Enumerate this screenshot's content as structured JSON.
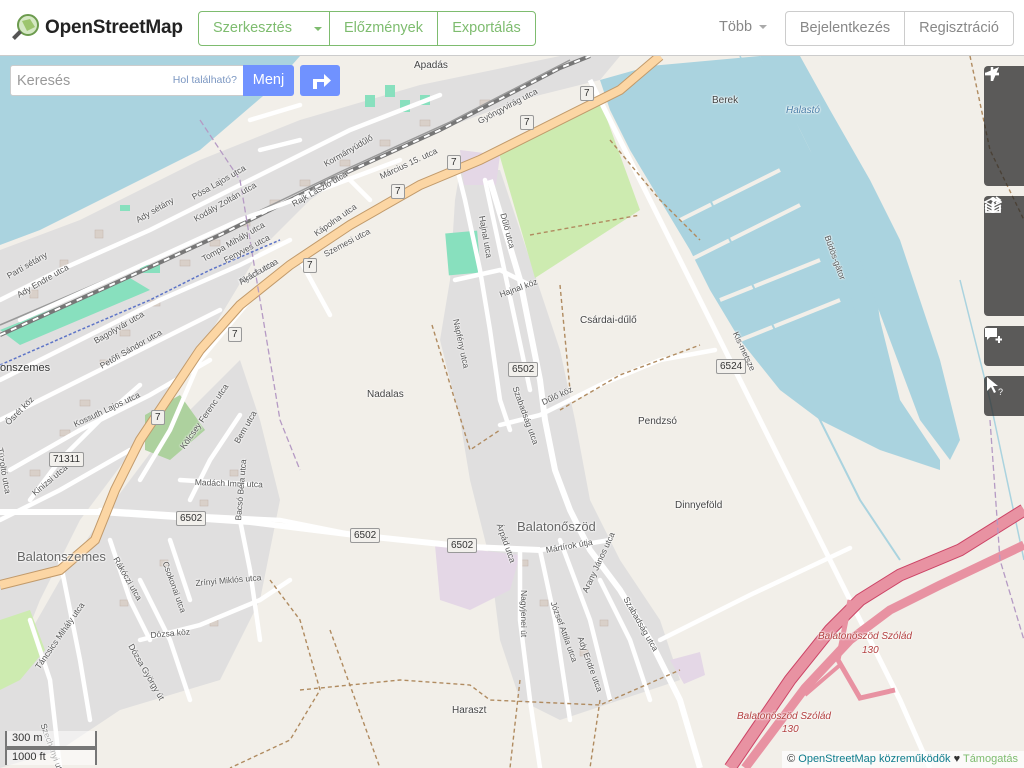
{
  "header": {
    "title": "OpenStreetMap",
    "edit_label": "Szerkesztés",
    "history_label": "Előzmények",
    "export_label": "Exportálás",
    "more_label": "Több",
    "login_label": "Bejelentkezés",
    "signup_label": "Regisztráció"
  },
  "search": {
    "placeholder": "Keresés",
    "where_label": "Hol található?",
    "go_label": "Menj"
  },
  "map": {
    "places": [
      "Apadás",
      "Berek",
      "Halastó",
      "Csárdai-dűlő",
      "Nadalas",
      "Pendzsó",
      "Dinnyeföld",
      "Balatonőszöd",
      "Balatonszemes",
      "Haraszt",
      "onszemes"
    ],
    "road_refs": [
      "7",
      "6502",
      "6524",
      "71311",
      "130"
    ],
    "motorway_label": "Balatonőszöd Szólád",
    "streets": [
      "Szemesi utca",
      "Szabadság utca",
      "Dűlő utca",
      "Hajnal utca",
      "Napfény utca",
      "Hajnal köz",
      "Dűlő köz",
      "Mártírok útja",
      "Árpád utca",
      "Madách Imre utca",
      "Kölcsey Ferenc utca",
      "Bem utca",
      "Kossuth Lajos utca",
      "Petőfi Sándor utca",
      "Bagolyvár utca",
      "Ady Endre utca",
      "Parti sétány",
      "Ady sétány",
      "Pósa Lajos utca",
      "Kodály Zoltán utca",
      "Tompa Mihály utca",
      "Fenyves utca",
      "Rajk László utca",
      "Kápolna utca",
      "Nyárfa utca",
      "Akácf utca",
      "Március 15. utca",
      "Kormányúdűlő",
      "Gyöngyvirág utca",
      "Csokonai utca",
      "Zrínyi Miklós utca",
      "Bacsó Béla utca",
      "Rákóczi utca",
      "Kinizsi utca",
      "Dózsa köz",
      "Dózsa György út",
      "Táncsics Mihály utca",
      "József Attila utca",
      "Arany János utca",
      "Ady Endre utca",
      "Szabadság utca",
      "Nagyjenei út",
      "Tüzoltó utca",
      "Ősrét köz",
      "Szechenyi utca",
      "Bűdös-gátor",
      "Kis-metsze"
    ],
    "scale_metric": "300 m",
    "scale_imperial": "1000 ft"
  },
  "attribution": {
    "copyright": "©",
    "osm_link": "OpenStreetMap közreműködők",
    "heart": "♥",
    "donate": "Támogatás"
  },
  "controls": [
    "zoom-in-icon",
    "zoom-out-icon",
    "locate-icon",
    "layers-icon",
    "info-icon",
    "share-icon",
    "note-icon",
    "query-icon"
  ],
  "colors": {
    "brand_green": "#7ebc6f",
    "button_blue": "#7092ff",
    "water": "#aad3df",
    "land": "#f2efe9",
    "residential": "#e0dfdf",
    "primary_road": "#fcd6a4",
    "motorway": "#e892a2",
    "park": "#cdebb0"
  }
}
